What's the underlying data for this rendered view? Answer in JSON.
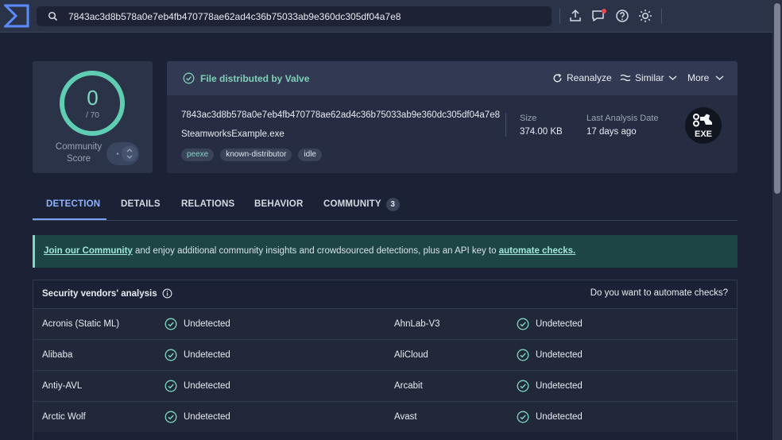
{
  "search": {
    "value": "7843ac3d8b578a0e7eb4fb470778ae62ad4c36b75033ab9e360dc305df04a7e8"
  },
  "score": {
    "value": "0",
    "total": "/ 70",
    "community_label": "Community Score"
  },
  "file": {
    "distributed_by": "File distributed by Valve",
    "reanalyze": "Reanalyze",
    "similar": "Similar",
    "more": "More",
    "hash": "7843ac3d8b578a0e7eb4fb470778ae62ad4c36b75033ab9e360dc305df04a7e8",
    "name": "SteamworksExample.exe",
    "tags": [
      "peexe",
      "known-distributor",
      "idle"
    ],
    "size_label": "Size",
    "size_value": "374.00 KB",
    "analysis_label": "Last Analysis Date",
    "analysis_value": "17 days ago",
    "type_badge": "EXE"
  },
  "tabs": [
    {
      "label": "DETECTION"
    },
    {
      "label": "DETAILS"
    },
    {
      "label": "RELATIONS"
    },
    {
      "label": "BEHAVIOR"
    },
    {
      "label": "COMMUNITY",
      "count": "3"
    }
  ],
  "banner": {
    "link1": "Join our Community",
    "text": " and enjoy additional community insights and crowdsourced detections, plus an API key to ",
    "link2": "automate checks."
  },
  "vendors": {
    "title": "Security vendors' analysis",
    "automate": "Do you want to automate checks?",
    "rows": [
      {
        "left_name": "Acronis (Static ML)",
        "left_result": "Undetected",
        "right_name": "AhnLab-V3",
        "right_result": "Undetected"
      },
      {
        "left_name": "Alibaba",
        "left_result": "Undetected",
        "right_name": "AliCloud",
        "right_result": "Undetected"
      },
      {
        "left_name": "Antiy-AVL",
        "left_result": "Undetected",
        "right_name": "Arcabit",
        "right_result": "Undetected"
      },
      {
        "left_name": "Arctic Wolf",
        "left_result": "Undetected",
        "right_name": "Avast",
        "right_result": "Undetected"
      }
    ]
  },
  "colors": {
    "accent_green": "#7fd8c2",
    "accent_blue": "#8fb3ff",
    "background": "#1c2235"
  }
}
